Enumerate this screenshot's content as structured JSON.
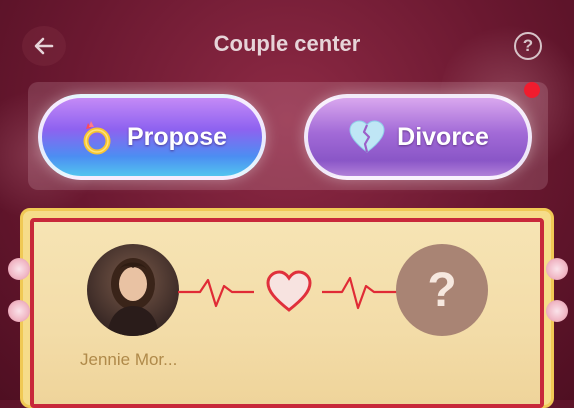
{
  "header": {
    "title": "Couple center",
    "back_icon": "arrow-left-icon",
    "help_icon": "question-circle-icon",
    "help_glyph": "?"
  },
  "actions": {
    "propose": {
      "label": "Propose",
      "icon": "ring-icon"
    },
    "divorce": {
      "label": "Divorce",
      "icon": "broken-heart-icon"
    },
    "has_notification": true
  },
  "couple_card": {
    "user": {
      "name": "Jennie Mor...",
      "avatar_icon": "user-avatar"
    },
    "link_icon": "heart-icon",
    "partner": {
      "placeholder_glyph": "?",
      "icon": "question-mark-icon"
    }
  },
  "colors": {
    "background": "#6a1830",
    "card_fill": "#f3dca8",
    "card_border": "#c8283a",
    "card_frame": "#f6dc8a",
    "pulse_line": "#e02b36",
    "notification_dot": "#f01c2e",
    "propose_gradient_top": "#c48af6",
    "propose_gradient_bottom": "#52c4ef",
    "divorce_gradient": "#a26ad7"
  }
}
